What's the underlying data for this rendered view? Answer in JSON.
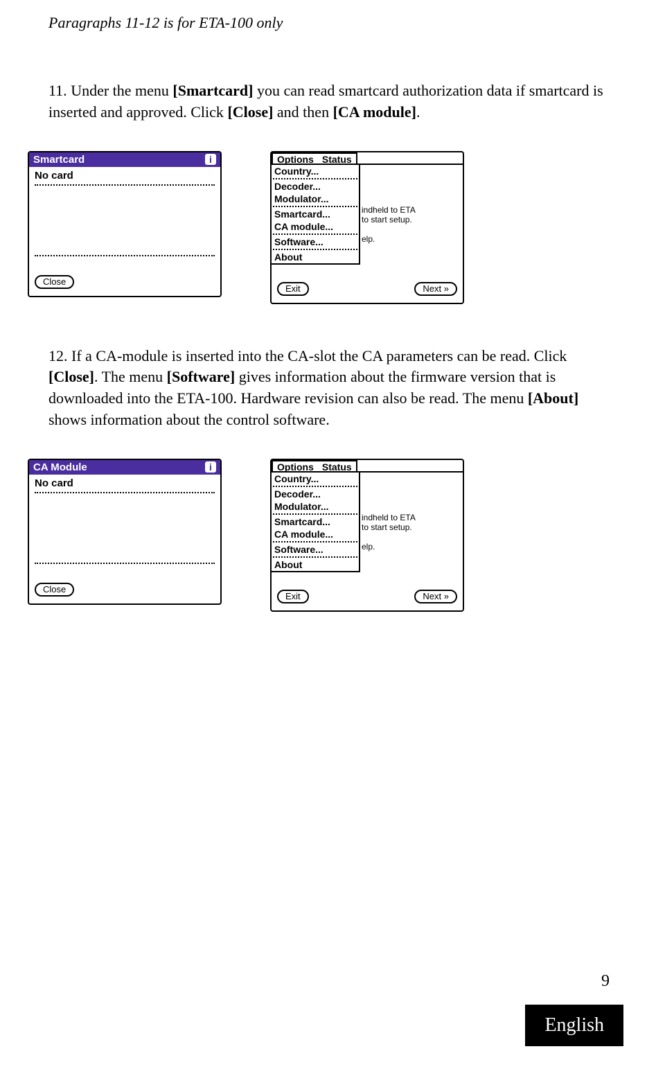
{
  "header_note": "Paragraphs 11-12 is for ETA-100 only",
  "para11": {
    "num": "11.",
    "t1": " Under the menu ",
    "b1": "[Smartcard]",
    "t2": " you can read smartcard authorization data if smartcard is inserted and approved. Click ",
    "b2": "[Close]",
    "t3": " and then ",
    "b3": "[CA module]",
    "t4": "."
  },
  "para12": {
    "num": "12.",
    "t1": " If a CA-module is inserted into the CA-slot the CA parameters can be read. Click ",
    "b1": "[Close]",
    "t2": ". The menu ",
    "b2": "[Software]",
    "t3": " gives information about the firmware version that is downloaded into the ETA-100. Hardware revision can also be read. The menu ",
    "b3": "[About]",
    "t4": " shows information about the control software."
  },
  "screen1": {
    "title": "Smartcard",
    "body": "No card",
    "close": "Close"
  },
  "screen2": {
    "tab1": "Options",
    "tab2": "Status",
    "menu": {
      "country": "Country...",
      "decoder": "Decoder...",
      "modulator": "Modulator...",
      "smartcard": "Smartcard...",
      "camodule": "CA module...",
      "software": "Software...",
      "about": "About"
    },
    "bg": {
      "l1": "indheld to ETA",
      "l2": "to start setup.",
      "l3": "elp."
    },
    "exit": "Exit",
    "next": "Next »"
  },
  "screen3": {
    "title": "CA Module",
    "body": "No card",
    "close": "Close"
  },
  "page_number": "9",
  "language": "English"
}
